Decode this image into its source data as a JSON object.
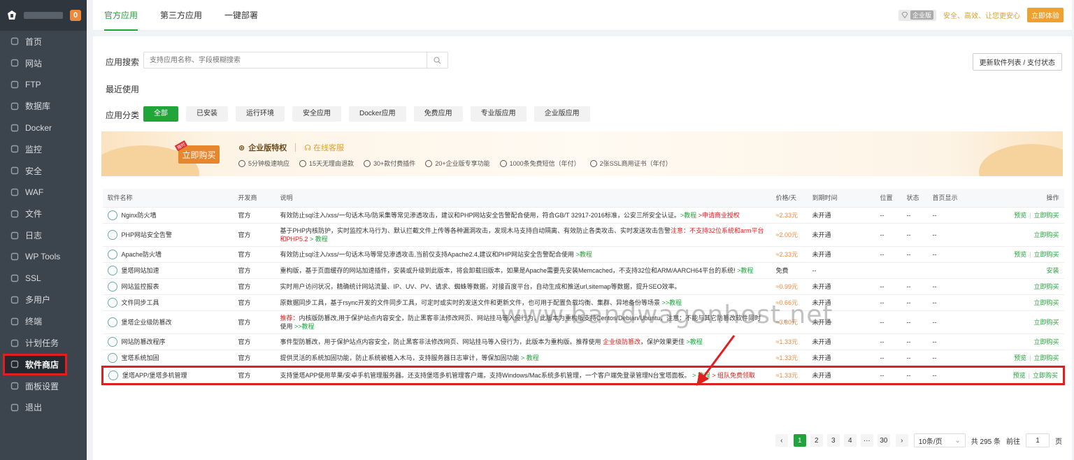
{
  "sidebar": {
    "badge": "0",
    "items": [
      {
        "label": "首页",
        "icon": "home-icon"
      },
      {
        "label": "网站",
        "icon": "globe-icon"
      },
      {
        "label": "FTP",
        "icon": "ftp-icon"
      },
      {
        "label": "数据库",
        "icon": "database-icon"
      },
      {
        "label": "Docker",
        "icon": "docker-icon"
      },
      {
        "label": "监控",
        "icon": "monitor-icon"
      },
      {
        "label": "安全",
        "icon": "shield-icon"
      },
      {
        "label": "WAF",
        "icon": "waf-icon"
      },
      {
        "label": "文件",
        "icon": "folder-icon"
      },
      {
        "label": "日志",
        "icon": "log-icon"
      },
      {
        "label": "WP Tools",
        "icon": "wordpress-icon"
      },
      {
        "label": "SSL",
        "icon": "ssl-icon"
      },
      {
        "label": "多用户",
        "icon": "users-icon"
      },
      {
        "label": "终端",
        "icon": "terminal-icon"
      },
      {
        "label": "计划任务",
        "icon": "calendar-icon"
      },
      {
        "label": "软件商店",
        "icon": "grid-icon"
      },
      {
        "label": "面板设置",
        "icon": "settings-icon"
      },
      {
        "label": "退出",
        "icon": "logout-icon"
      }
    ]
  },
  "tabs": [
    "官方应用",
    "第三方应用",
    "一键部署"
  ],
  "topbar": {
    "edition": "企业版",
    "slogan": "安全、高效、让您更安心",
    "try_btn": "立即体验"
  },
  "search": {
    "label": "应用搜索",
    "placeholder": "支持应用名称、字段模糊搜索",
    "update_btn": "更新软件列表 / 支付状态"
  },
  "recent_label": "最近使用",
  "category": {
    "label": "应用分类",
    "items": [
      "全部",
      "已安装",
      "运行环境",
      "安全应用",
      "Docker应用",
      "免费应用",
      "专业版应用",
      "企业版应用"
    ]
  },
  "banner": {
    "buy": "立即购买",
    "buy_tag": "限时",
    "title": "企业版特权",
    "service": "在线客服",
    "features": [
      "5分钟极速响应",
      "15天无理由退款",
      "30+款付费插件",
      "20+企业版专享功能",
      "1000条免费短信（年付）",
      "2张SSL商用证书（年付）"
    ]
  },
  "table": {
    "headers": [
      "软件名称",
      "开发商",
      "说明",
      "价格/天",
      "到期时间",
      "位置",
      "状态",
      "首页显示",
      "操作"
    ],
    "rows": [
      {
        "name": "Nginx防火墙",
        "dev": "官方",
        "desc": "有效防止sql注入/xss/一句话木马/防采集等常见渗透攻击，建议和PHP网站安全告警配合使用，符合GB/T 32917-2016标准，公安三所安全认证。",
        "desc_green": ">教程",
        "desc_red": " >申请商业授权",
        "price": "≈2.33元",
        "expire": "未开通",
        "pos": "--",
        "status": "--",
        "home": "--",
        "preview": "预览",
        "action": "立即购买"
      },
      {
        "name": "PHP网站安全告警",
        "dev": "官方",
        "desc": "基于PHP内核防护，实时监控木马行为、默认拦截文件上传等各种漏洞攻击，发现木马支持自动隔离、有效防止各类攻击、实时发送攻击告警",
        "desc_red": "注意：不支持32位系统和arm平台和PHP5.2",
        "desc_green": " > 教程",
        "price": "≈2.00元",
        "expire": "未开通",
        "pos": "--",
        "status": "--",
        "home": "--",
        "preview": "",
        "action": "立即购买"
      },
      {
        "name": "Apache防火墙",
        "dev": "官方",
        "desc": "有效防止sql注入/xss/一句话木马等常见渗透攻击,当前仅支持Apache2.4,建议和PHP网站安全告警配合使用",
        "desc_green": " >教程",
        "desc_red": "",
        "price": "≈2.33元",
        "expire": "未开通",
        "pos": "--",
        "status": "--",
        "home": "--",
        "preview": "预览",
        "action": "立即购买"
      },
      {
        "name": "堡塔网站加速",
        "dev": "官方",
        "desc": "重构版，基于页面缓存的网站加速插件，安装或升级到此版本，将会卸载旧版本，如果是Apache需要先安装Memcached，不支持32位和ARM/AARCH64平台的系统!",
        "desc_green": " >教程",
        "desc_red": "",
        "price": "免费",
        "expire": "--",
        "pos": "",
        "status": "",
        "home": "",
        "preview": "",
        "action": "安装"
      },
      {
        "name": "网站监控报表",
        "dev": "官方",
        "desc": "实时用户访问状况，精确统计网站流量、IP、UV、PV、请求、蜘蛛等数据，对接百度平台，自动生成和推送url,sitemap等数据，提升SEO效率。",
        "desc_green": "",
        "desc_red": "",
        "price": "≈0.99元",
        "expire": "未开通",
        "pos": "--",
        "status": "--",
        "home": "--",
        "preview": "",
        "action": "立即购买"
      },
      {
        "name": "文件同步工具",
        "dev": "官方",
        "desc": "原数据同步工具，基于rsync开发的文件同步工具，可定时或实时的发送文件和更新文件，也可用于配置负载均衡、集群、异地备份等场景",
        "desc_green": " >>教程",
        "desc_red": "",
        "price": "≈0.66元",
        "expire": "未开通",
        "pos": "--",
        "status": "--",
        "home": "--",
        "preview": "",
        "action": "立即购买"
      },
      {
        "name": "堡塔企业级防篡改",
        "dev": "官方",
        "desc_pre_red": "推荐：",
        "desc": "内核版防篡改,用于保护站点内容安全，防止黑客非法修改网页、网站挂马等入侵行为，此版本为重构版支持Centos/Debian/Ubuntu，注意：不能与其它防篡改软件同时使用",
        "desc_green": " >>教程",
        "desc_red": "",
        "price": "≈3.30元",
        "expire": "未开通",
        "pos": "--",
        "status": "--",
        "home": "--",
        "preview": "",
        "action": "立即购买"
      },
      {
        "name": "网站防篡改程序",
        "dev": "官方",
        "desc": "事件型防篡改，用于保护站点内容安全，防止黑客非法修改网页、网站挂马等入侵行为，此版本为重构版。推荐使用",
        "desc_red": " 企业级防篡改",
        "desc_tail": "，保护效果更佳",
        "desc_green": " >教程",
        "price": "≈1.33元",
        "expire": "未开通",
        "pos": "--",
        "status": "--",
        "home": "--",
        "preview": "",
        "action": "立即购买"
      },
      {
        "name": "宝塔系统加固",
        "dev": "官方",
        "desc": "提供灵活的系统加固功能，防止系统被植入木马，支持服务器日志审计，等保加固功能",
        "desc_green": " > 教程",
        "desc_red": "",
        "price": "≈1.33元",
        "expire": "未开通",
        "pos": "--",
        "status": "--",
        "home": "--",
        "preview": "预览",
        "action": "立即购买"
      },
      {
        "name": "堡塔APP/堡塔多机管理",
        "dev": "官方",
        "desc": "支持堡塔APP使用苹果/安卓手机管理服务器。还支持堡塔多机管理客户端，支持Windows/Mac系统多机管理，一个客户端免登录管理N台宝塔面板。",
        "desc_red": " > 组队免费领取",
        "desc_green": " > 教程",
        "price": "≈1.33元",
        "expire": "未开通",
        "pos": "--",
        "status": "--",
        "home": "--",
        "preview": "预览",
        "action": "立即购买"
      }
    ]
  },
  "pager": {
    "pages": [
      "1",
      "2",
      "3",
      "4",
      "···",
      "30"
    ],
    "page_size": "10条/页",
    "total": "共 295 条",
    "goto": "前往",
    "goto_val": "1",
    "page_unit": "页"
  },
  "watermark": "www.bandwagonhost.net"
}
